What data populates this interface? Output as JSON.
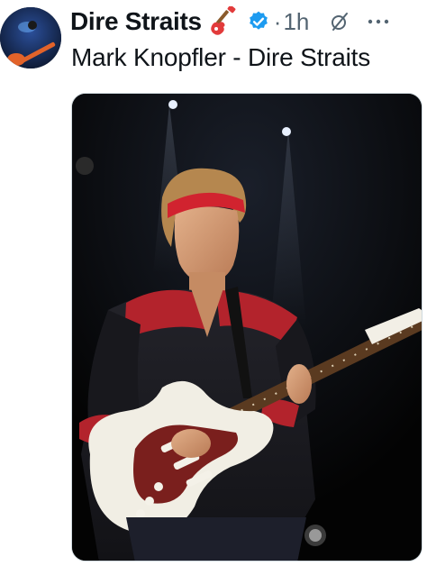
{
  "post": {
    "display_name": "Dire Straits",
    "separator": "·",
    "timestamp": "1h",
    "text": "Mark Knopfler - Dire Straits"
  },
  "icons": {
    "avatar": "avatar-guitarist",
    "name_emoji": "guitar-emoji-icon",
    "verified": "verified-badge-icon",
    "grok": "grok-icon",
    "more": "more-options-icon"
  },
  "colors": {
    "text_primary": "#0f1419",
    "text_secondary": "#536471",
    "verified_blue": "#1d9bf0",
    "media_border": "#cfd9de"
  }
}
